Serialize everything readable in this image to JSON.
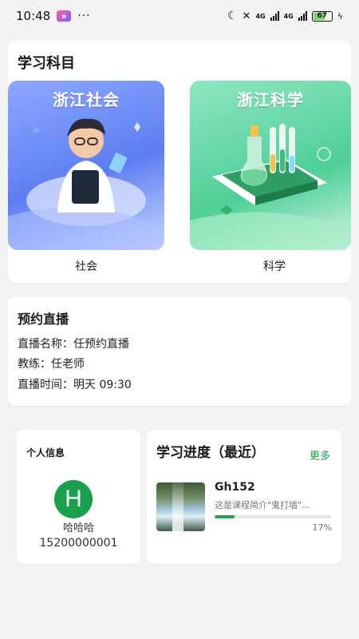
{
  "status": {
    "time": "10:48",
    "dots": "···",
    "battery": "67",
    "net1": "4G",
    "net2": "4G"
  },
  "subjects": {
    "title": "学习科目",
    "items": [
      {
        "banner": "浙江社会",
        "label": "社会"
      },
      {
        "banner": "浙江科学",
        "label": "科学"
      }
    ]
  },
  "live": {
    "title": "预约直播",
    "name_line": "直播名称：任预约直播",
    "teacher_line": "教练：任老师",
    "time_line": "直播时间：明天 09:30"
  },
  "profile": {
    "title": "个人信息",
    "avatar_letter": "H",
    "name": "哈哈哈",
    "phone": "15200000001"
  },
  "progress": {
    "title": "学习进度（最近）",
    "more_label": "更多",
    "course": {
      "name": "Gh152",
      "desc": "这是课程简介\"鬼打墙\"...",
      "progress": 0.17,
      "percent_label": "17%"
    }
  },
  "colors": {
    "accent": "#1a9f4c",
    "background": "#f3f3f3"
  }
}
